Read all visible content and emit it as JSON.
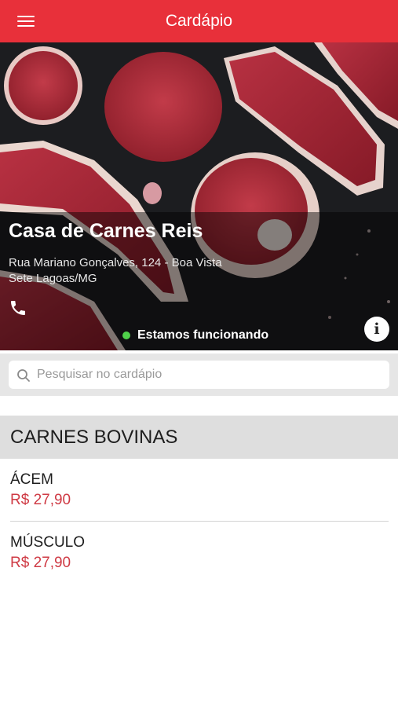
{
  "header": {
    "title": "Cardápio",
    "menu_icon": "hamburger-menu-icon",
    "bar_color": "#e8303a"
  },
  "store": {
    "name": "Casa de Carnes Reis",
    "address_line1": "Rua Mariano Gonçalves, 124 - Boa Vista",
    "address_line2": "Sete Lagoas/MG",
    "phone_icon": "phone-icon",
    "status_text": "Estamos funcionando",
    "status_color": "#4fd04a",
    "info_icon": "info-icon",
    "info_glyph": "i"
  },
  "search": {
    "placeholder": "Pesquisar no cardápio",
    "value": ""
  },
  "menu": {
    "categories": [
      {
        "title": "CARNES BOVINAS",
        "items": [
          {
            "name": "ÁCEM",
            "price": "R$ 27,90"
          },
          {
            "name": "MÚSCULO",
            "price": "R$ 27,90"
          }
        ]
      }
    ],
    "price_color": "#cf3a44"
  }
}
